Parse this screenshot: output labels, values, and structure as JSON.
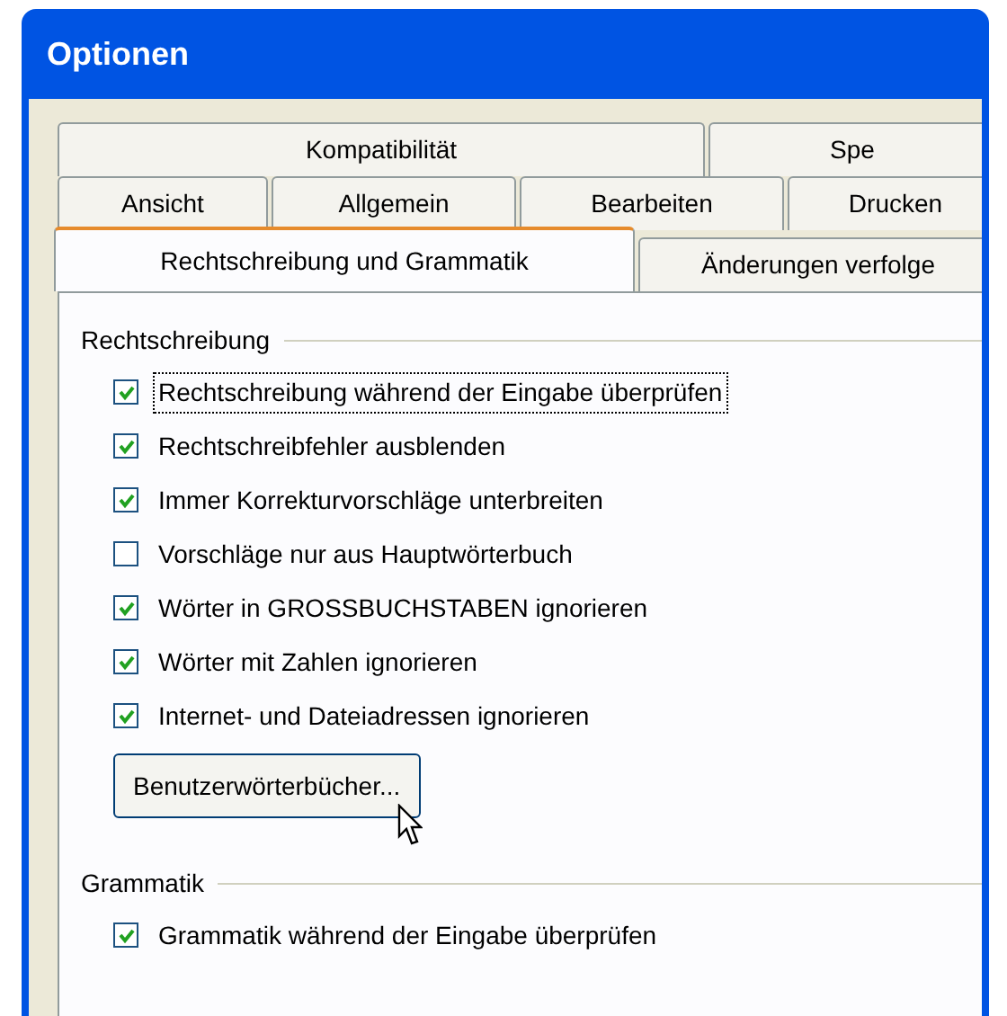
{
  "window": {
    "title": "Optionen"
  },
  "tab_rows": [
    [
      {
        "label": "Kompatibilität",
        "selected": false
      },
      {
        "label": "Spe",
        "selected": false
      }
    ],
    [
      {
        "label": "Ansicht",
        "selected": false
      },
      {
        "label": "Allgemein",
        "selected": false
      },
      {
        "label": "Bearbeiten",
        "selected": false
      },
      {
        "label": "Drucken",
        "selected": false
      }
    ],
    [
      {
        "label": "Rechtschreibung und Grammatik",
        "selected": true
      },
      {
        "label": "Änderungen verfolge",
        "selected": false
      }
    ]
  ],
  "groups": [
    {
      "title": "Rechtschreibung",
      "options": [
        {
          "label": "Rechtschreibung während der Eingabe überprüfen",
          "checked": true,
          "focused": true
        },
        {
          "label": "Rechtschreibfehler ausblenden",
          "checked": true,
          "focused": false
        },
        {
          "label": "Immer Korrekturvorschläge unterbreiten",
          "checked": true,
          "focused": false
        },
        {
          "label": "Vorschläge nur aus Hauptwörterbuch",
          "checked": false,
          "focused": false
        },
        {
          "label": "Wörter in GROSSBUCHSTABEN ignorieren",
          "checked": true,
          "focused": false
        },
        {
          "label": "Wörter mit Zahlen ignorieren",
          "checked": true,
          "focused": false
        },
        {
          "label": "Internet- und Dateiadressen ignorieren",
          "checked": true,
          "focused": false
        }
      ],
      "button": "Benutzerwörterbücher..."
    },
    {
      "title": "Grammatik",
      "options": [
        {
          "label": "Grammatik während der Eingabe überprüfen",
          "checked": true,
          "focused": false
        }
      ]
    }
  ]
}
